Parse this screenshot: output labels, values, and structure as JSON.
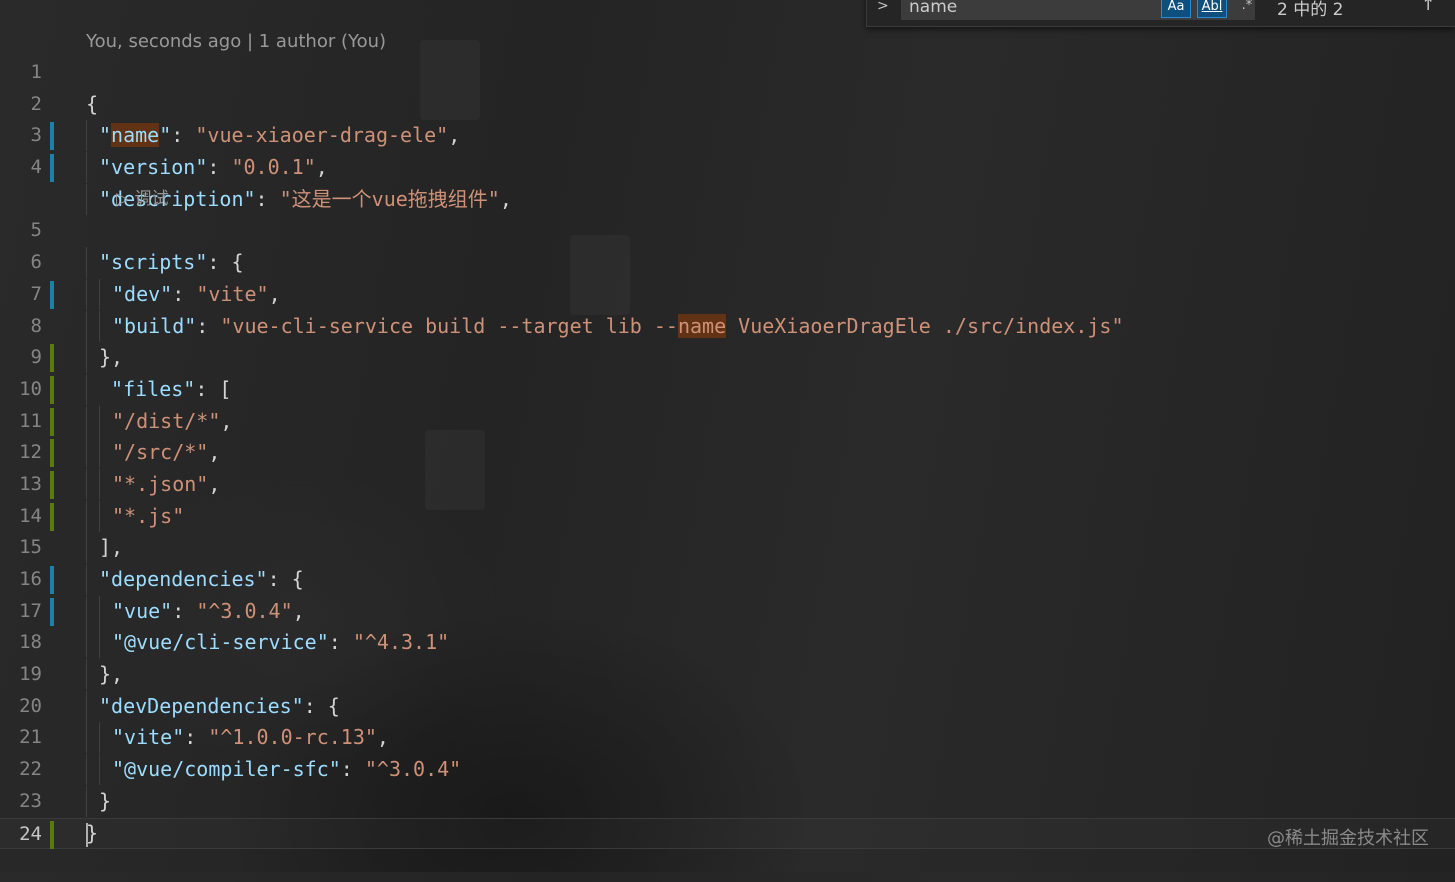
{
  "find_widget": {
    "query": "name",
    "match_case_label": "Aa",
    "whole_word_label": "Abl",
    "regex_label": ".*",
    "result_count": "2 中的 2",
    "prev_label": "↑"
  },
  "blame": "You, seconds ago | 1 author (You)",
  "codelens_debug": "▷ 调试",
  "lines": [
    {
      "n": "1"
    },
    {
      "n": "2"
    },
    {
      "n": "3"
    },
    {
      "n": "4"
    },
    {
      "n": "5"
    },
    {
      "n": "6"
    },
    {
      "n": "7"
    },
    {
      "n": "8"
    },
    {
      "n": "9"
    },
    {
      "n": "10"
    },
    {
      "n": "11"
    },
    {
      "n": "12"
    },
    {
      "n": "13"
    },
    {
      "n": "14"
    },
    {
      "n": "15"
    },
    {
      "n": "16"
    },
    {
      "n": "17"
    },
    {
      "n": "18"
    },
    {
      "n": "19"
    },
    {
      "n": "20"
    },
    {
      "n": "21"
    },
    {
      "n": "22"
    },
    {
      "n": "23"
    },
    {
      "n": "24"
    }
  ],
  "code": {
    "l1": "{",
    "name_key": "name",
    "name_val": "\"vue-xiaoer-drag-ele\"",
    "version_key": "\"version\"",
    "version_val": "\"0.0.1\"",
    "description_key": "\"description\"",
    "description_val": "\"这是一个vue拖拽组件\"",
    "scripts_key": "\"scripts\"",
    "dev_key": "\"dev\"",
    "dev_val": "\"vite\"",
    "build_key": "\"build\"",
    "build_val_pre": "\"vue-cli-service build --target lib --",
    "build_val_match": "name",
    "build_val_post": " VueXiaoerDragEle ./src/index.js\"",
    "files_key": "\"files\"",
    "f1": "\"/dist/*\"",
    "f2": "\"/src/*\"",
    "f3": "\"*.json\"",
    "f4": "\"*.js\"",
    "deps_key": "\"dependencies\"",
    "vue_key": "\"vue\"",
    "vue_val": "\"^3.0.4\"",
    "cli_key": "\"@vue/cli-service\"",
    "cli_val": "\"^4.3.1\"",
    "devdeps_key": "\"devDependencies\"",
    "vite_key": "\"vite\"",
    "vite_val": "\"^1.0.0-rc.13\"",
    "sfc_key": "\"@vue/compiler-sfc\"",
    "sfc_val": "\"^3.0.4\""
  },
  "watermark": "@稀土掘金技术社区",
  "colors": {
    "key": "#9cdcfe",
    "string": "#ce9178",
    "find_match": "#613214",
    "gutter_modified": "#1b81a8",
    "gutter_added": "#587c0c"
  }
}
